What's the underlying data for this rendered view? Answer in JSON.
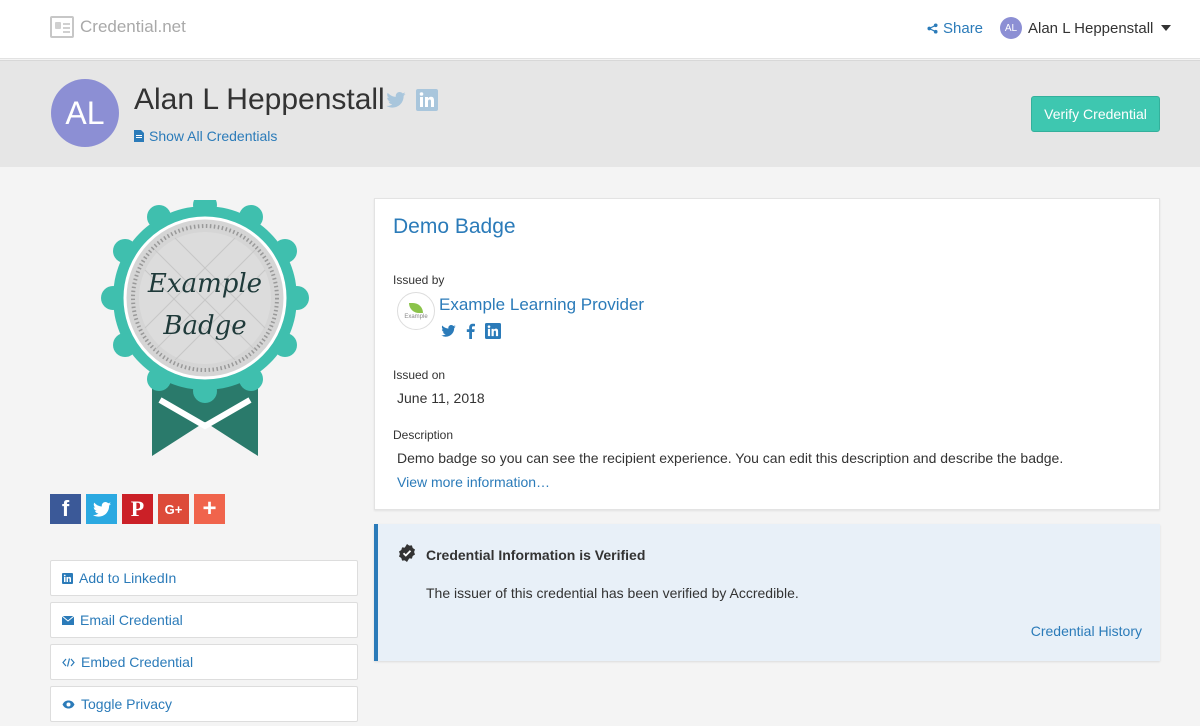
{
  "nav": {
    "brand": "Credential.net",
    "share_label": "Share",
    "user_initials": "AL",
    "user_name": "Alan L Heppenstall"
  },
  "header": {
    "initials": "AL",
    "name": "Alan L Heppenstall",
    "show_all_label": "Show All Credentials",
    "verify_label": "Verify Credential"
  },
  "badge": {
    "line1": "Example",
    "line2": "Badge"
  },
  "share_icons": [
    {
      "icon": "facebook-icon",
      "glyph": "f",
      "color": "#3b5998"
    },
    {
      "icon": "twitter-icon",
      "glyph": "",
      "color": "#2ba9e1"
    },
    {
      "icon": "pinterest-icon",
      "glyph": "P",
      "color": "#cb2027"
    },
    {
      "icon": "google-plus-icon",
      "glyph": "G+",
      "color": "#dd4b39"
    },
    {
      "icon": "add-more-icon",
      "glyph": "+",
      "color": "#f0644c"
    }
  ],
  "side_buttons": {
    "linkedin": "Add to LinkedIn",
    "email": "Email Credential",
    "embed": "Embed Credential",
    "privacy": "Toggle Privacy"
  },
  "credential": {
    "title": "Demo Badge",
    "issued_by_label": "Issued by",
    "issuer_logo_text": "Example",
    "issuer_name": "Example Learning Provider",
    "issued_on_label": "Issued on",
    "issued_on": "June 11, 2018",
    "description_label": "Description",
    "description": "Demo badge so you can see the recipient experience. You can edit this description and describe the badge.",
    "view_more": "View more information…"
  },
  "verification": {
    "title": "Credential Information is Verified",
    "text": "The issuer of this credential has been verified by Accredible.",
    "history_label": "Credential History"
  },
  "colors": {
    "accent_blue": "#2b7bb9",
    "teal": "#3ec7b0",
    "avatar": "#8c8fd4"
  }
}
